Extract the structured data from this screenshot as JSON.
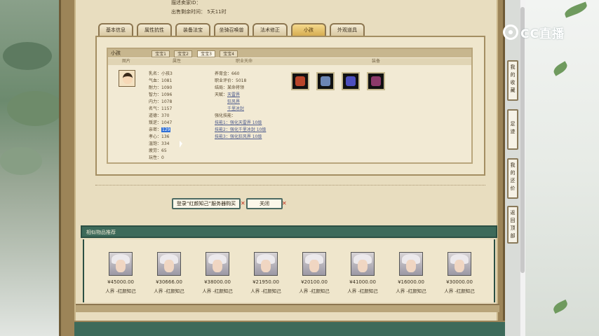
{
  "top": {
    "seller_id_label": "描述卖家ID：",
    "time_left_label": "出售剩余时间：",
    "time_left_value": "5天11时"
  },
  "tabs": [
    {
      "label": "基本信息"
    },
    {
      "label": "属性抗性"
    },
    {
      "label": "装备法宝"
    },
    {
      "label": "坐骑召唤兽"
    },
    {
      "label": "法术修正"
    },
    {
      "label": "小孩"
    },
    {
      "label": "外观道具"
    }
  ],
  "active_tab": "小孩",
  "panel": {
    "title": "小孩",
    "subtabs": [
      "宝宝1",
      "宝宝2",
      "宝宝3",
      "宝宝4"
    ],
    "active_subtab": "宝宝3",
    "columns": {
      "image": "图片",
      "attributes": "属性",
      "career": "职业天命",
      "equipment": "装备"
    }
  },
  "child_stats": [
    {
      "label": "乳名：",
      "value": "小孩3"
    },
    {
      "label": "气血：",
      "value": "1081"
    },
    {
      "label": "耐力：",
      "value": "1090"
    },
    {
      "label": "智力：",
      "value": "1096"
    },
    {
      "label": "内力：",
      "value": "1078"
    },
    {
      "label": "名气：",
      "value": "1157"
    },
    {
      "label": "道德：",
      "value": "370"
    },
    {
      "label": "叛逆：",
      "value": "1047"
    },
    {
      "label": "亲密：",
      "value": "129"
    },
    {
      "label": "孝心：",
      "value": "136"
    },
    {
      "label": "温饱：",
      "value": "334"
    },
    {
      "label": "疲劳：",
      "value": "65"
    },
    {
      "label": "玩性：",
      "value": "0"
    }
  ],
  "career": {
    "money_label": "养育金：",
    "money_value": "660",
    "career_score_label": "职业评价：",
    "career_score_value": "5018",
    "ending_label": "结局：",
    "ending_value": "某命将领",
    "destiny_label": "天赋：",
    "destinies": [
      "天雷界",
      "狂风界",
      "千里冰封"
    ],
    "enhance_label": "强化技能：",
    "skills": [
      "技能1：强化天雷界 10级",
      "技能2：强化千里冰封 10级",
      "技能3：强化狂风界 10级"
    ]
  },
  "equipment": [
    {
      "icon": "helmet-icon",
      "color": "#b8452a"
    },
    {
      "icon": "robe-icon",
      "color": "#6c86b4"
    },
    {
      "icon": "weapon-icon",
      "color": "#4d4fbd"
    },
    {
      "icon": "armor-icon",
      "color": "#8c3a6a"
    }
  ],
  "buttons": {
    "login_buy": "登录“红颜知己”服务器购买",
    "close": "关闭"
  },
  "recommend": {
    "title": "相似物品推荐",
    "items": [
      {
        "price": "¥45000.00",
        "name": "人界 -红颜知己"
      },
      {
        "price": "¥30666.00",
        "name": "人界 -红颜知己"
      },
      {
        "price": "¥38000.00",
        "name": "人界 -红颜知己"
      },
      {
        "price": "¥21950.00",
        "name": "人界 -红颜知己"
      },
      {
        "price": "¥20100.00",
        "name": "人界 -红颜知己"
      },
      {
        "price": "¥41000.00",
        "name": "人界 -红颜知己"
      },
      {
        "price": "¥16000.00",
        "name": "人界 -红颜知己"
      },
      {
        "price": "¥30000.00",
        "name": "人界 -红颜知己"
      }
    ]
  },
  "side_nav": [
    {
      "label": "我的收藏"
    },
    {
      "label": "足迹"
    },
    {
      "label": "我的还价"
    },
    {
      "label": "返回顶部"
    }
  ],
  "brand": {
    "logo_text": "CC直播"
  }
}
